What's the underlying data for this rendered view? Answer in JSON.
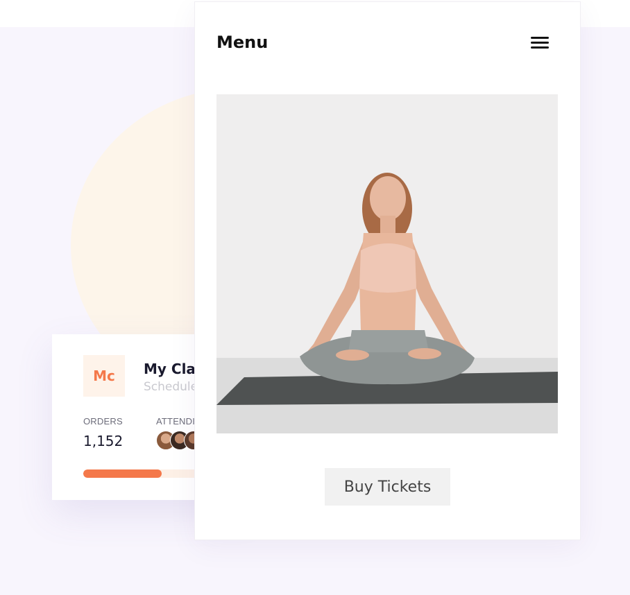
{
  "colors": {
    "accent": "#f4784a",
    "accent_light": "#fdf0e6",
    "background": "#f8f5fd",
    "blob": "#fdf5ea"
  },
  "phone": {
    "menu_title": "Menu",
    "menu_icon": "hamburger-icon",
    "buy_button_label": "Buy Tickets"
  },
  "class_card": {
    "badge_text": "Mc",
    "title": "My Clas",
    "subtitle": "Schedule",
    "orders_label": "ORDERS",
    "orders_value": "1,152",
    "attendees_label": "ATTENDI",
    "progress_fraction": 0.49
  }
}
